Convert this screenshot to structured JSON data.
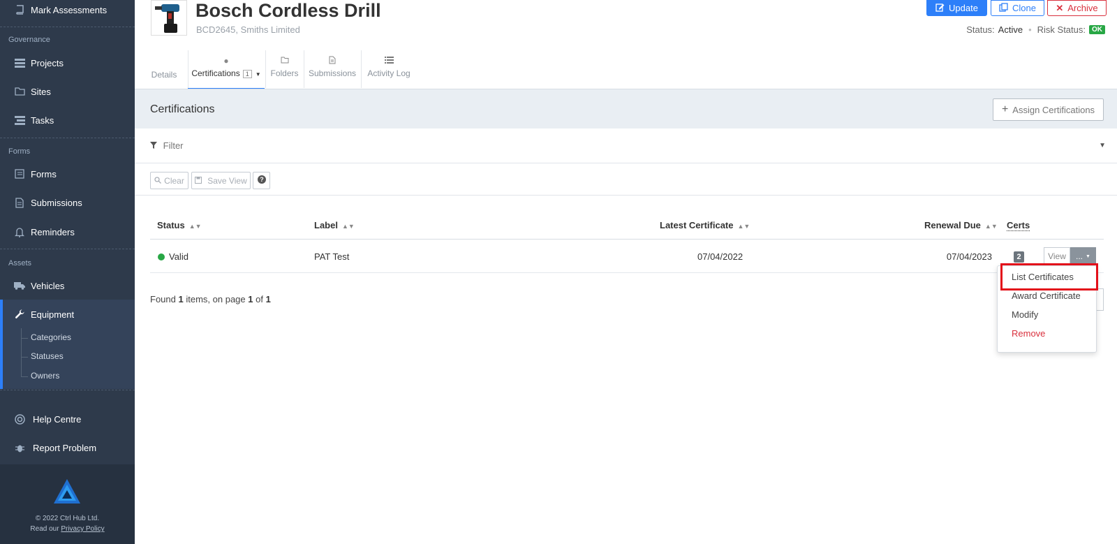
{
  "sidebar": {
    "top_item": "Mark Assessments",
    "sections": {
      "governance": "Governance",
      "forms": "Forms",
      "assets": "Assets"
    },
    "items": {
      "projects": "Projects",
      "sites": "Sites",
      "tasks": "Tasks",
      "forms": "Forms",
      "submissions": "Submissions",
      "reminders": "Reminders",
      "vehicles": "Vehicles",
      "equipment": "Equipment",
      "help_centre": "Help Centre",
      "report_problem": "Report Problem"
    },
    "equipment_sub": {
      "categories": "Categories",
      "statuses": "Statuses",
      "owners": "Owners"
    },
    "footer": {
      "copyright": "© 2022 Ctrl Hub Ltd.",
      "read_our": "Read our",
      "privacy_policy": "Privacy Policy"
    }
  },
  "header": {
    "title": "Bosch Cordless Drill",
    "subtitle": "BCD2645, Smiths Limited",
    "buttons": {
      "update": "Update",
      "clone": "Clone",
      "archive": "Archive"
    },
    "status_label": "Status:",
    "status_value": "Active",
    "risk_label": "Risk Status:",
    "risk_value": "OK"
  },
  "tabs": {
    "details": "Details",
    "certifications": "Certifications",
    "certifications_count": "1",
    "folders": "Folders",
    "submissions": "Submissions",
    "activity_log": "Activity Log"
  },
  "certifications": {
    "heading": "Certifications",
    "assign_button": "Assign Certifications",
    "filter_label": "Filter",
    "toolbar": {
      "clear": "Clear",
      "save_view": "Save View"
    },
    "columns": {
      "status": "Status",
      "label": "Label",
      "latest_certificate": "Latest Certificate",
      "renewal_due": "Renewal Due",
      "certs": "Certs"
    },
    "rows": [
      {
        "status": "Valid",
        "label": "PAT Test",
        "latest_certificate": "07/04/2022",
        "renewal_due": "07/04/2023",
        "certs": "2"
      }
    ],
    "row_actions": {
      "view": "View",
      "more": "..."
    },
    "found": {
      "prefix": "Found",
      "count": "1",
      "middle": "items, on page",
      "page": "1",
      "of": "of",
      "total_pages": "1"
    }
  },
  "dropdown": {
    "items": {
      "list_certificates": "List Certificates",
      "award_certificate": "Award Certificate",
      "modify": "Modify",
      "remove": "Remove"
    }
  },
  "colors": {
    "sidebar_bg": "#2e3a4b",
    "accent": "#2d7ff9",
    "danger": "#d9303d",
    "success": "#28a745",
    "highlight": "#e3101a"
  }
}
